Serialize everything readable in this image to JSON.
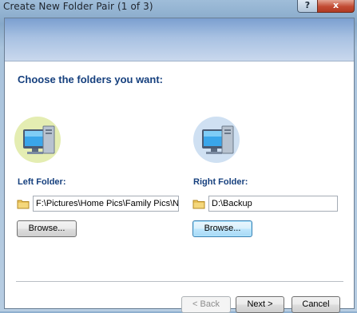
{
  "window": {
    "title": "Create New Folder Pair (1 of 3)",
    "help_label": "?",
    "close_label": "x"
  },
  "main": {
    "heading": "Choose the folders you want:",
    "left": {
      "label": "Left Folder:",
      "path": "F:\\Pictures\\Home Pics\\Family Pics\\Nal",
      "browse_label": "Browse..."
    },
    "right": {
      "label": "Right Folder:",
      "path": "D:\\Backup",
      "browse_label": "Browse..."
    }
  },
  "footer": {
    "back_label": "< Back",
    "next_label": "Next >",
    "cancel_label": "Cancel"
  },
  "colors": {
    "heading": "#16407e",
    "left_halo": "#e3ecb0",
    "right_halo": "#cfe0f2"
  },
  "icons": {
    "computer": "computer-icon",
    "folder": "folder-icon"
  }
}
